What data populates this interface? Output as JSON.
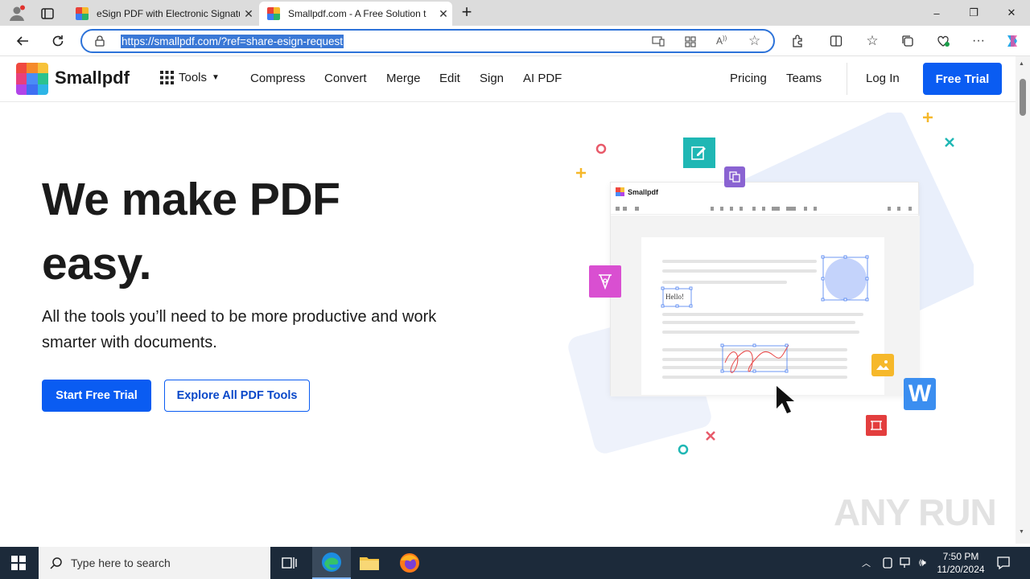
{
  "browser": {
    "tabs": [
      {
        "title": "eSign PDF with Electronic Signatu",
        "active": false
      },
      {
        "title": "Smallpdf.com - A Free Solution t",
        "active": true
      }
    ],
    "new_tab_glyph": "+",
    "close_glyph": "✕",
    "url": "https://smallpdf.com/?ref=share-esign-request",
    "window_controls": {
      "minimize": "–",
      "maximize": "❐",
      "close": "✕"
    }
  },
  "site": {
    "logo_text": "Smallpdf",
    "nav": {
      "tools": "Tools",
      "links": [
        "Compress",
        "Convert",
        "Merge",
        "Edit",
        "Sign",
        "AI PDF"
      ],
      "pricing": "Pricing",
      "teams": "Teams",
      "login": "Log In",
      "free_trial": "Free Trial"
    },
    "hero": {
      "title_line1": "We make PDF",
      "title_line2": "easy.",
      "subtitle_line1": "All the tools you’ll need to be more productive and work",
      "subtitle_line2": "smarter with documents.",
      "primary_cta": "Start Free Trial",
      "secondary_cta": "Explore All PDF Tools"
    },
    "illustration": {
      "app_name": "Smallpdf",
      "hello_text": "Hello!",
      "word_icon_letter": "W"
    },
    "watermark": "ANY RUN"
  },
  "taskbar": {
    "search_placeholder": "Type here to search",
    "time": "7:50 PM",
    "date": "11/20/2024"
  },
  "colors": {
    "brand_blue": "#0a5cf2",
    "accent_teal": "#1fb7b4",
    "accent_purple": "#8a63d2",
    "accent_pink": "#d94fd1",
    "accent_red": "#e33e3e",
    "accent_yellow": "#f6b82a"
  }
}
